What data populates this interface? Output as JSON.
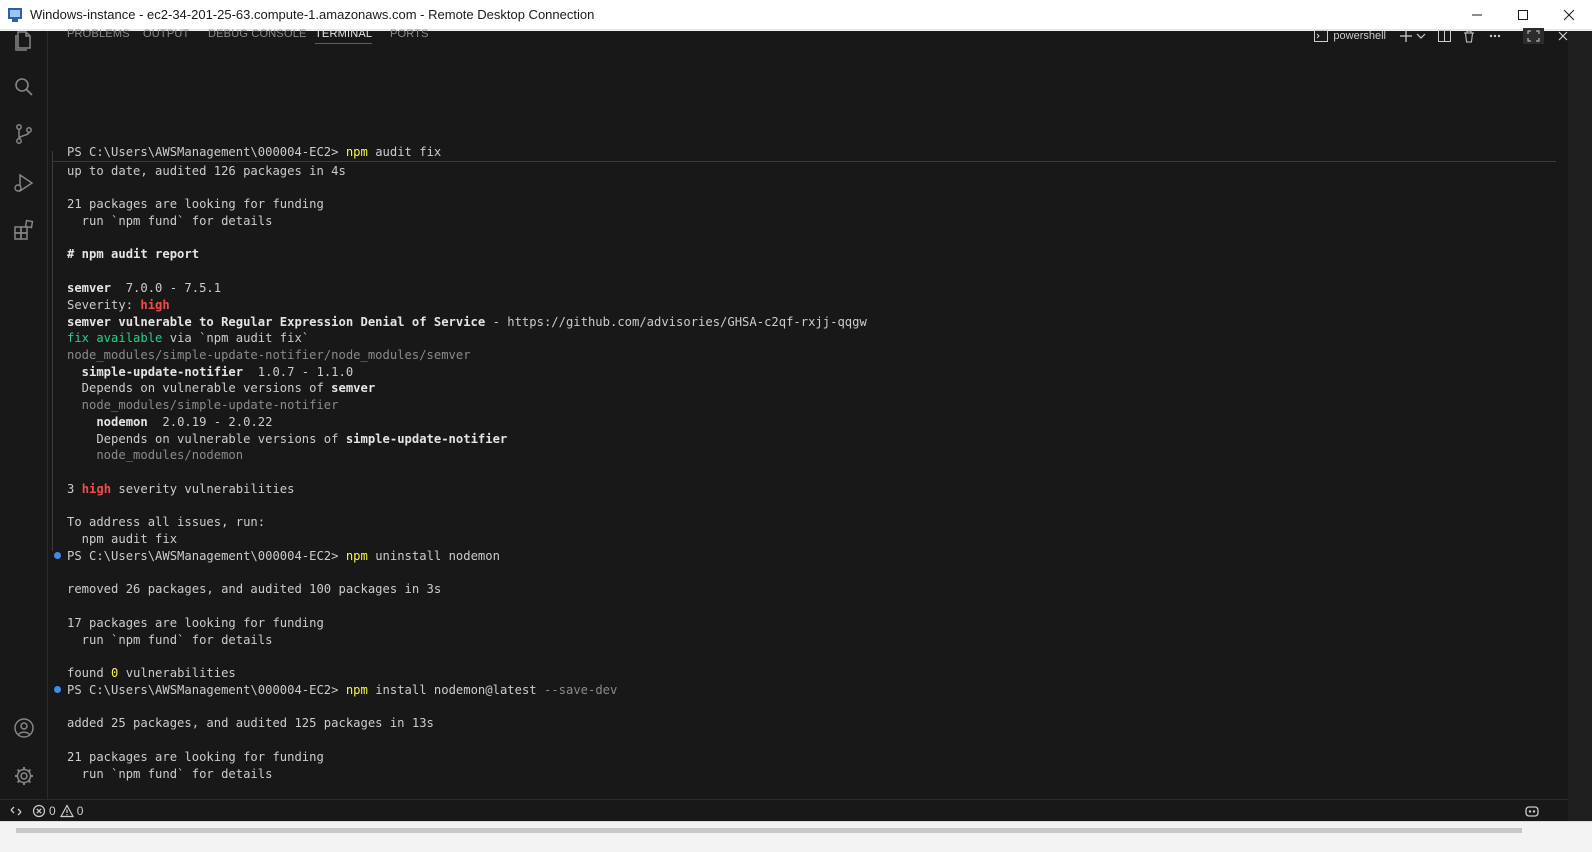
{
  "window": {
    "title": "Windows-instance - ec2-34-201-25-63.compute-1.amazonaws.com - Remote Desktop Connection",
    "minimize_icon": "minimize-icon",
    "maximize_icon": "maximize-icon",
    "close_icon": "close-icon"
  },
  "activity_bar": {
    "items": [
      "explorer-icon",
      "search-icon",
      "source-control-icon",
      "run-debug-icon",
      "extensions-icon"
    ],
    "bottom": [
      "account-icon",
      "settings-gear-icon"
    ]
  },
  "panel": {
    "tabs": [
      {
        "label": "PROBLEMS"
      },
      {
        "label": "OUTPUT"
      },
      {
        "label": "DEBUG CONSOLE"
      },
      {
        "label": "TERMINAL",
        "active": true
      },
      {
        "label": "PORTS"
      }
    ],
    "shell_label": "powershell"
  },
  "terminal": {
    "prompt": "PS C:\\Users\\AWSManagement\\000004-EC2>",
    "cmd1": {
      "npm": "npm",
      "args": "audit fix"
    },
    "l_up_to_date": "up to date, audited 126 packages in 4s",
    "l_funding_21": "21 packages are looking for funding",
    "l_fund_details": "  run `npm fund` for details",
    "l_report": "# npm audit report",
    "l_semver_name": "semver",
    "l_semver_range": "  7.0.0 - 7.5.1",
    "l_severity_label": "Severity: ",
    "l_high": "high",
    "l_vuln_title": "semver vulnerable to Regular Expression Denial of Service",
    "l_vuln_link": " - https://github.com/advisories/GHSA-c2qf-rxjj-qqgw",
    "l_fix_available": "fix available",
    "l_fix_via": " via `npm audit fix`",
    "l_path_semver": "node_modules/simple-update-notifier/node_modules/semver",
    "l_sun_name": "  simple-update-notifier",
    "l_sun_range": "  1.0.7 - 1.1.0",
    "l_depends_1a": "  Depends on vulnerable versions of ",
    "l_depends_1b": "semver",
    "l_path_sun": "  node_modules/simple-update-notifier",
    "l_nodemon_name": "    nodemon",
    "l_nodemon_range": "  2.0.19 - 2.0.22",
    "l_depends_2a": "    Depends on vulnerable versions of ",
    "l_depends_2b": "simple-update-notifier",
    "l_path_nodemon": "    node_modules/nodemon",
    "l_count_3": "3 ",
    "l_severity_vulns": " severity vulnerabilities",
    "l_address": "To address all issues, run:",
    "l_audit_fix": "  npm audit fix",
    "cmd2": {
      "npm": "npm",
      "args": "uninstall nodemon"
    },
    "l_removed": "removed 26 packages, and audited 100 packages in 3s",
    "l_funding_17": "17 packages are looking for funding",
    "l_found_0_a": "found ",
    "l_found_0_b": "0",
    "l_found_0_c": " vulnerabilities",
    "cmd3": {
      "npm": "npm",
      "args": "install nodemon@latest",
      "flag": " --save-dev"
    },
    "l_added": "added 25 packages, and audited 125 packages in 13s"
  },
  "statusbar": {
    "errors": "0",
    "warnings": "0"
  }
}
